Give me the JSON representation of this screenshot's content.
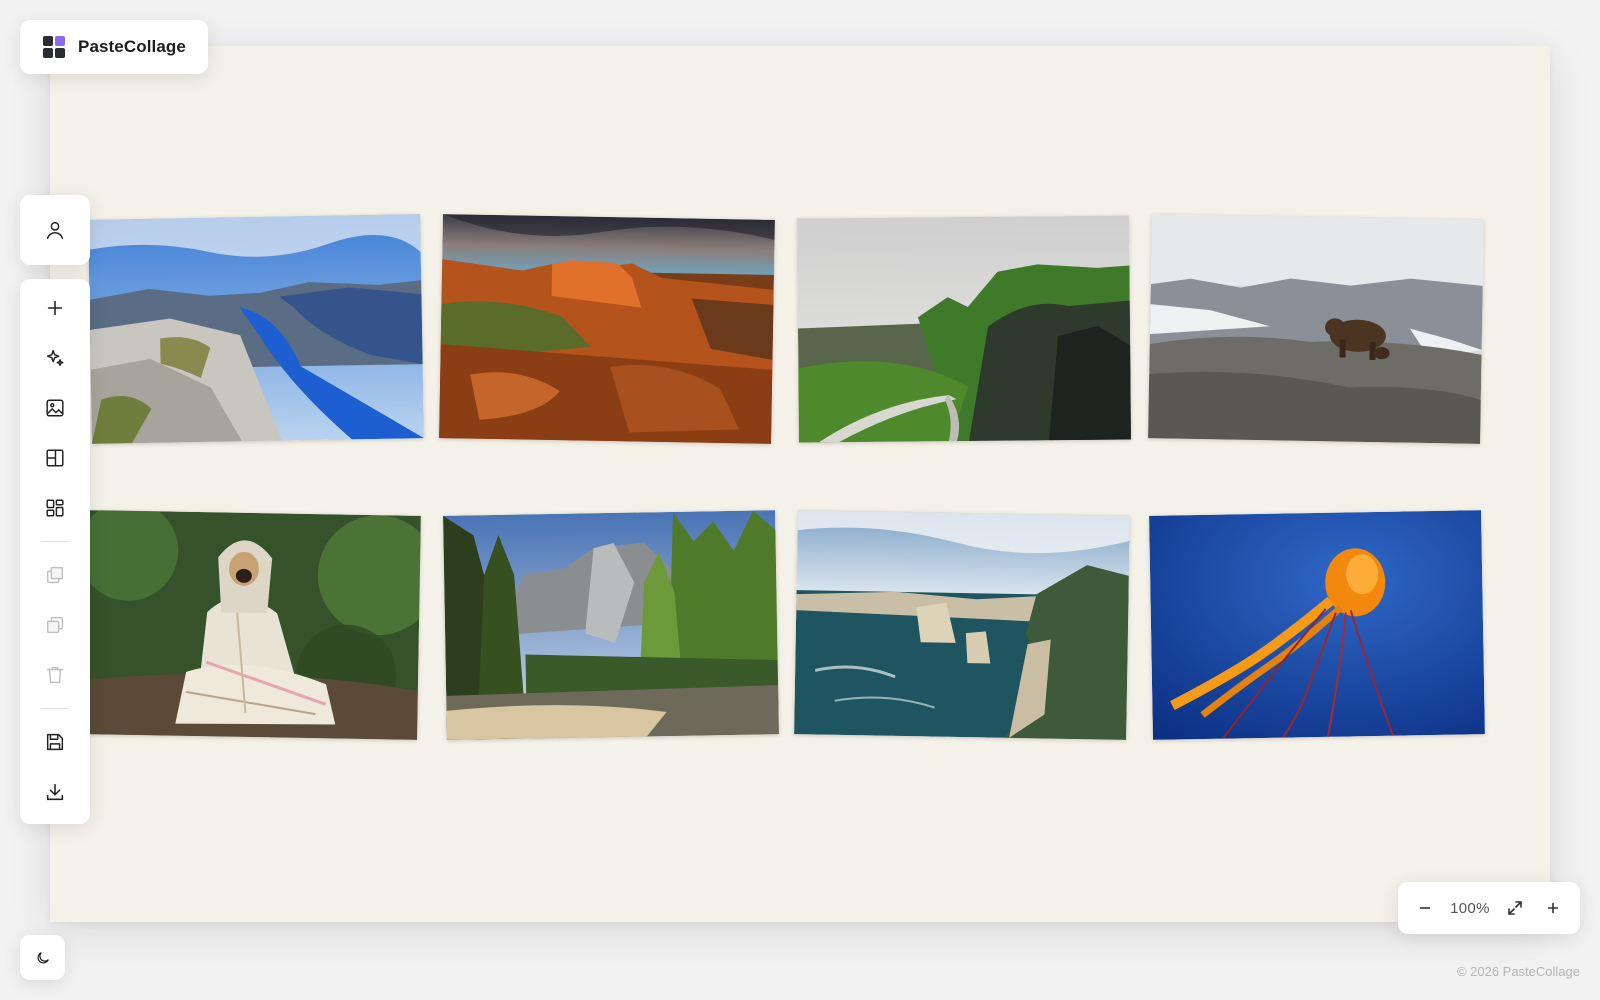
{
  "app": {
    "name": "PasteCollage"
  },
  "toolbar": {
    "account_icon": "user-icon",
    "tools": [
      {
        "id": "add",
        "icon": "plus-icon",
        "enabled": true
      },
      {
        "id": "magic",
        "icon": "sparkles-icon",
        "enabled": true
      },
      {
        "id": "image",
        "icon": "image-icon",
        "enabled": true
      },
      {
        "id": "layout",
        "icon": "layout-icon",
        "enabled": true
      },
      {
        "id": "grid",
        "icon": "grid-icon",
        "enabled": true
      },
      {
        "id": "bring-forward",
        "icon": "bring-forward-icon",
        "enabled": false
      },
      {
        "id": "send-backward",
        "icon": "send-backward-icon",
        "enabled": false
      },
      {
        "id": "delete",
        "icon": "trash-icon",
        "enabled": false
      },
      {
        "id": "save",
        "icon": "save-icon",
        "enabled": true
      },
      {
        "id": "download",
        "icon": "download-icon",
        "enabled": true
      }
    ]
  },
  "canvas": {
    "background": "#f4f1e8",
    "photos": [
      {
        "subject": "fjord"
      },
      {
        "subject": "red-rock-sunset"
      },
      {
        "subject": "green-highlands-road"
      },
      {
        "subject": "bear-on-rock"
      },
      {
        "subject": "pug-in-blanket"
      },
      {
        "subject": "yosemite-valley"
      },
      {
        "subject": "coastal-cliffs"
      },
      {
        "subject": "jellyfish"
      }
    ]
  },
  "zoom": {
    "level": "100%",
    "minus_icon": "minus-icon",
    "fit_icon": "expand-icon",
    "plus_icon": "plus-icon"
  },
  "theme_toggle": {
    "icon": "moon-icon"
  },
  "footer": {
    "copyright": "© 2026 PasteCollage"
  }
}
